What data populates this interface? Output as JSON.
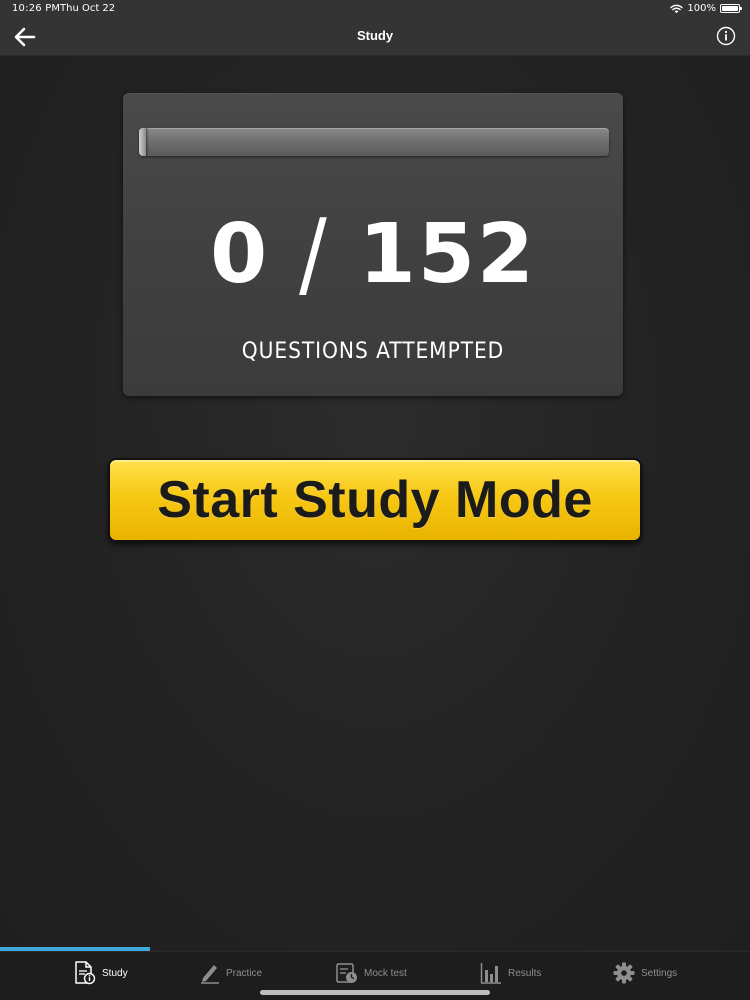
{
  "status_bar": {
    "time": "10:26 PM",
    "date": "Thu Oct 22",
    "battery": "100%"
  },
  "nav": {
    "title": "Study",
    "back_icon": "arrow-left-icon",
    "info_icon": "info-icon"
  },
  "progress": {
    "attempted": "0",
    "total": "152",
    "separator": "/",
    "fraction": 0,
    "caption": "QUESTIONS ATTEMPTED"
  },
  "start_button": {
    "label": "Start Study Mode"
  },
  "tabs": [
    {
      "label": "Study",
      "icon": "study-document-icon",
      "active": true
    },
    {
      "label": "Practice",
      "icon": "pencil-icon",
      "active": false
    },
    {
      "label": "Mock test",
      "icon": "mock-test-icon",
      "active": false
    },
    {
      "label": "Results",
      "icon": "bar-chart-icon",
      "active": false
    },
    {
      "label": "Settings",
      "icon": "gear-icon",
      "active": false
    }
  ],
  "colors": {
    "accent": "#3fa9dc",
    "button": "#f7c815",
    "background": "#232323"
  }
}
